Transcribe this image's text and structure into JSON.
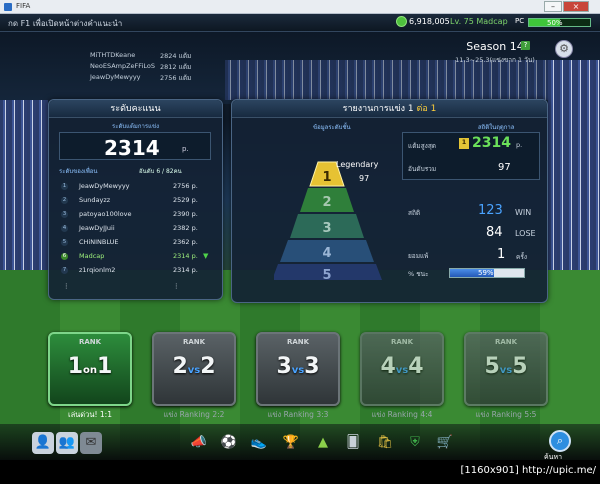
{
  "window": {
    "title": "FIFA"
  },
  "topbar": {
    "message": "กด F1 เพื่อเปิดหน้าต่างคำแนะนำ",
    "gp": "6,918,005",
    "level": "Lv. 75 Madcap",
    "pc": "PC",
    "progress_label": "50%",
    "progress": 0.5
  },
  "notices": [
    {
      "name": "MiTHTDKeane",
      "score": "2824",
      "unit": "แต้ม"
    },
    {
      "name": "NeoESAmpZeFFiLoS",
      "score": "2812",
      "unit": "แต้ม"
    },
    {
      "name": "JeawDyMewyyy",
      "score": "2756",
      "unit": "แต้ม"
    }
  ],
  "season": {
    "title": "Season 14",
    "help": "?",
    "dates": "11.3~25.3(แข่งขาก 1 วัน)"
  },
  "left_panel": {
    "title": "ระดับคะแนน",
    "subtitle": "ระดับแต้มการแข่ง",
    "score": "2314",
    "score_unit": "p.",
    "tier_label": "ระดับของเพื่อน",
    "rank_label": "อันดับ 6 / 82คน",
    "rows": [
      {
        "i": "1",
        "name": "JeawDyMewyyy",
        "score": "2756 p."
      },
      {
        "i": "2",
        "name": "Sundayzz",
        "score": "2529 p."
      },
      {
        "i": "3",
        "name": "patoyao100love",
        "score": "2390 p."
      },
      {
        "i": "4",
        "name": "JeawDyJJuii",
        "score": "2382 p."
      },
      {
        "i": "5",
        "name": "CHiNINBLUE",
        "score": "2362 p."
      },
      {
        "i": "6",
        "name": "Madcap",
        "score": "2314 p."
      },
      {
        "i": "7",
        "name": "z1rqionlm2",
        "score": "2314 p."
      }
    ],
    "more": "⋮"
  },
  "right_panel": {
    "title": "รายงานการแข่ง 1 ต่อ 1",
    "title_main": "รายงานการแข่ง 1 ",
    "title_red": "ต่อ 1",
    "label_tier": "ข้อมูลระดับชั้น",
    "label_stats": "สถิติในฤดูกาล",
    "tier_name": "Legendary",
    "tier_value": "97",
    "pyramid": [
      "1",
      "2",
      "3",
      "4",
      "5"
    ],
    "best_label": "แต้มสูงสุด",
    "best_badge": "1",
    "best": "2314",
    "best_unit": "p.",
    "rank_label": "อันดับรวม",
    "rank": "97",
    "record_label": "สถิติ",
    "wins": "123",
    "win_label": "WIN",
    "losses": "84",
    "lose_label": "LOSE",
    "draw_label": "ยอมแพ้",
    "draws": "1",
    "draw_unit": "ครั้ง",
    "pct_label": "% ชนะ",
    "pct": "59%",
    "pct_value": 59
  },
  "modes": [
    {
      "rank": "RANK",
      "a": "1",
      "vs": "on",
      "b": "1",
      "label": "เล่นด่วน! 1:1"
    },
    {
      "rank": "RANK",
      "a": "2",
      "vs": "vs",
      "b": "2",
      "label": "แข่ง Ranking 2:2"
    },
    {
      "rank": "RANK",
      "a": "3",
      "vs": "vs",
      "b": "3",
      "label": "แข่ง Ranking 3:3"
    },
    {
      "rank": "RANK",
      "a": "4",
      "vs": "vs",
      "b": "4",
      "label": "แข่ง Ranking 4:4"
    },
    {
      "rank": "RANK",
      "a": "5",
      "vs": "vs",
      "b": "5",
      "label": "แข่ง Ranking 5:5"
    }
  ],
  "dock": {
    "search_label": "ค้นหา",
    "credit": "[1160x901] http://upic.me/"
  }
}
